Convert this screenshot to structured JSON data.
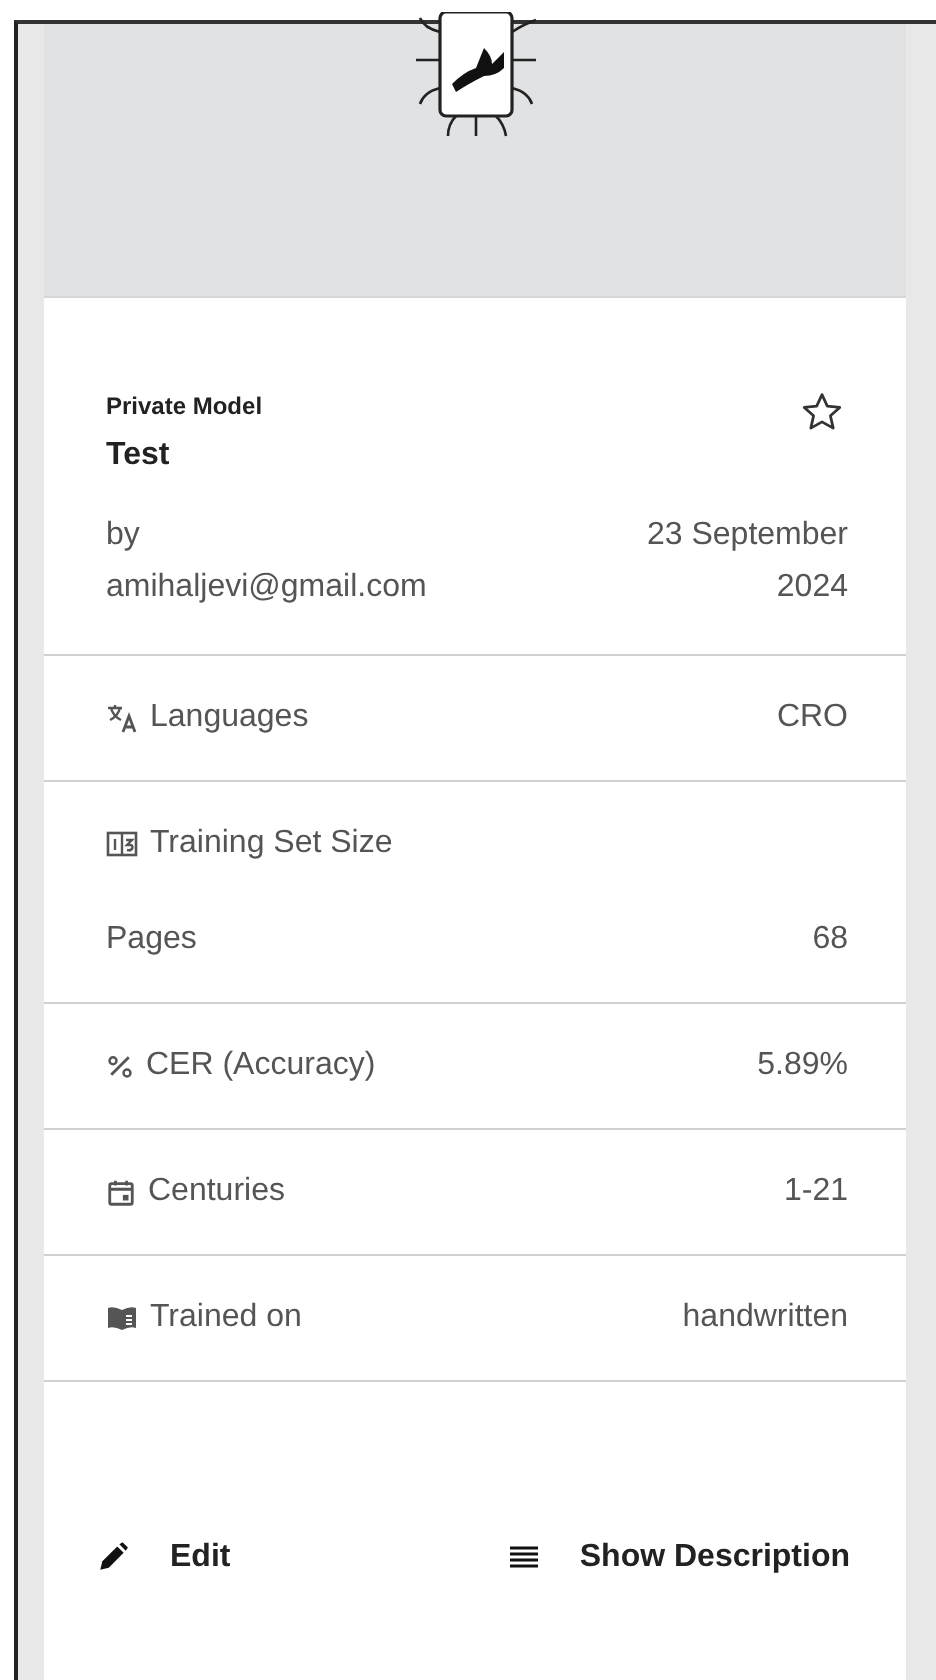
{
  "model": {
    "visibility": "Private Model",
    "name": "Test",
    "favorite": false,
    "author": "by amihaljevi@gmail.com",
    "date": "23 September 2024"
  },
  "properties": [
    {
      "label": "Languages",
      "value": "CRO"
    },
    {
      "label": "Training Set Size",
      "rows": [
        {
          "label": "Pages",
          "value": "68"
        }
      ]
    },
    {
      "label": "CER (Accuracy)",
      "value": "5.89%"
    },
    {
      "label": "Centuries",
      "value": "1-21"
    },
    {
      "label": "Trained on",
      "value": "handwritten"
    }
  ],
  "actions": [
    {
      "label": "Edit"
    },
    {
      "label": "Show Description"
    }
  ]
}
